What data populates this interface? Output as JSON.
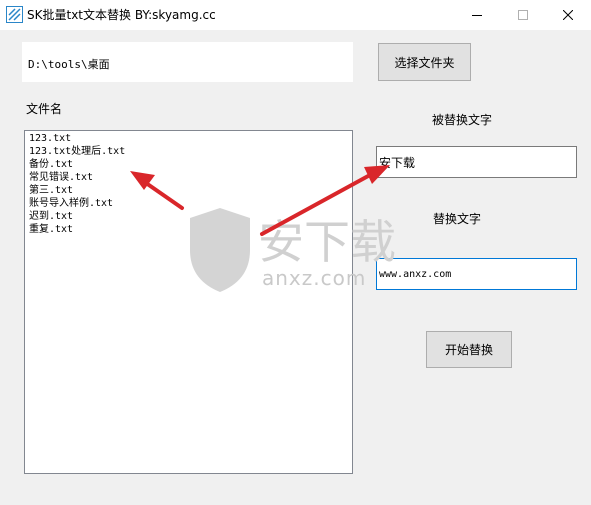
{
  "window": {
    "title": "SK批量txt文本替换 BY:skyamg.cc",
    "app_icon": "striped-square-icon",
    "controls": [
      "minimize-icon",
      "maximize-icon",
      "close-icon"
    ]
  },
  "folder": {
    "path": "D:\\tools\\桌面",
    "choose_button": "选择文件夹"
  },
  "files": {
    "label": "文件名",
    "items": [
      "123.txt",
      "123.txt处理后.txt",
      "备份.txt",
      "常见错误.txt",
      "第三.txt",
      "账号导入样例.txt",
      "迟到.txt",
      "重复.txt"
    ]
  },
  "search": {
    "label": "被替换文字",
    "value": "安下载"
  },
  "replace": {
    "label": "替换文字",
    "value": "www.anxz.com"
  },
  "start_button": "开始替换",
  "watermark": {
    "main": "安下载",
    "domain": "anxz.com"
  },
  "colors": {
    "arrow": "#d9262a",
    "focus_border": "#0078d7",
    "app_icon": "#2a86c8"
  }
}
